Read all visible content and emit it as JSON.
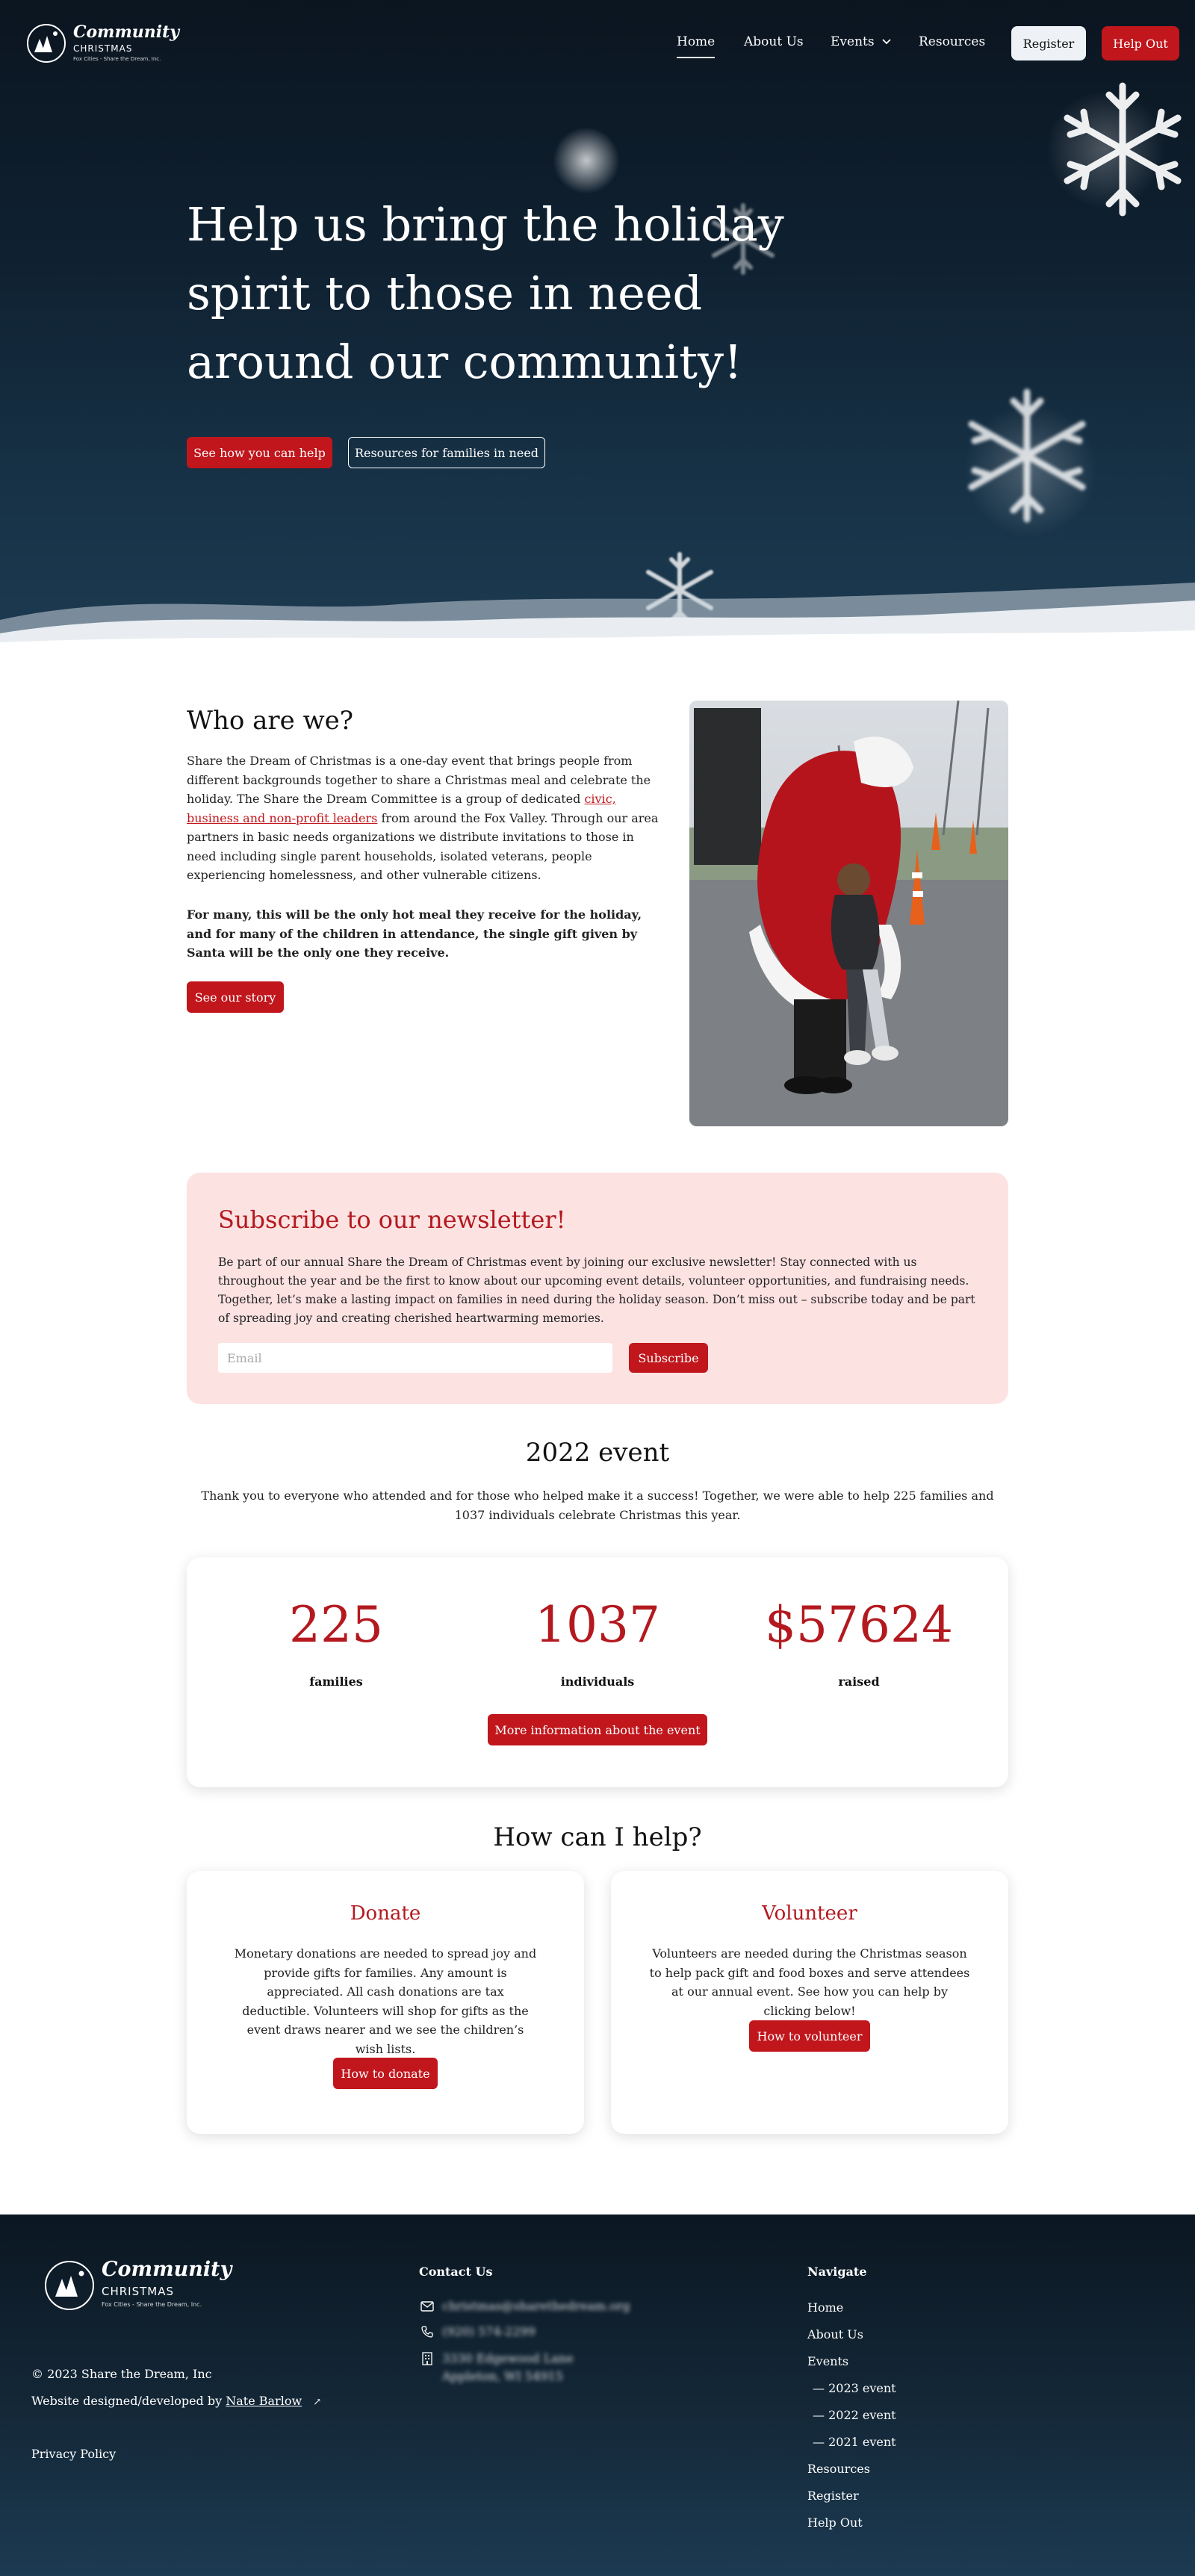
{
  "brand": {
    "script": "Community",
    "caps": "CHRISTMAS",
    "tagline": "Fox Cities - Share the Dream, Inc."
  },
  "nav": {
    "home": "Home",
    "about": "About Us",
    "events": "Events",
    "resources": "Resources",
    "register": "Register",
    "help_out": "Help Out"
  },
  "hero": {
    "title": "Help us bring the holiday spirit to those in need around our community!",
    "cta_primary": "See how you can help",
    "cta_secondary": "Resources for families in need"
  },
  "about": {
    "heading": "Who are we?",
    "p1_a": "Share the Dream of Christmas is a one-day event that brings people from different backgrounds together to share a Christmas meal and celebrate the holiday. The Share the Dream Committee is a group of dedicated ",
    "p1_link": "civic, business and non-profit leaders",
    "p1_b": " from around the Fox Valley. Through our area partners in basic needs organizations we distribute invitations to those in need including single parent households, isolated veterans, people experiencing homelessness, and other vulnerable citizens.",
    "p2": "For many, this will be the only hot meal they receive for the holiday, and for many of the children in attendance, the single gift given by Santa will be the only one they receive.",
    "button": "See our story"
  },
  "newsletter": {
    "heading": "Subscribe to our newsletter!",
    "body": "Be part of our annual Share the Dream of Christmas event by joining our exclusive newsletter! Stay connected with us throughout the year and be the first to know about our upcoming event details, volunteer opportunities, and fundraising needs. Together, let’s make a lasting impact on families in need during the holiday season. Don’t miss out – subscribe today and be part of spreading joy and creating cherished heartwarming memories.",
    "email_placeholder": "Email",
    "button": "Subscribe"
  },
  "event": {
    "heading": "2022 event",
    "text": "Thank you to everyone who attended and for those who helped make it a success! Together, we were able to help 225 families and 1037 individuals celebrate Christmas this year.",
    "stats": [
      {
        "value": "225",
        "label": "families"
      },
      {
        "value": "1037",
        "label": "individuals"
      },
      {
        "value": "$57624",
        "label": "raised"
      }
    ],
    "button": "More information about the event"
  },
  "help": {
    "heading": "How can I help?",
    "donate": {
      "title": "Donate",
      "text": "Monetary donations are needed to spread joy and provide gifts for families. Any amount is appreciated. All cash donations are tax deductible. Volunteers will shop for gifts as the event draws nearer and we see the children’s wish lists.",
      "button": "How to donate"
    },
    "volunteer": {
      "title": "Volunteer",
      "text": "Volunteers are needed during the Christmas season to help pack gift and food boxes and serve attendees at our annual event. See how you can help by clicking below!",
      "button": "How to volunteer"
    }
  },
  "footer": {
    "copyright": "© 2023 Share the Dream, Inc",
    "credit_prefix": "Website designed/developed by ",
    "credit_name": "Nate Barlow",
    "privacy": "Privacy Policy",
    "contact_heading": "Contact Us",
    "email": "christmas@sharethedream.org",
    "phone": "(920) 574-2299",
    "address1": "3330 Edgewood Lane",
    "address2": "Appleton, WI 54915",
    "navigate_heading": "Navigate",
    "nav": [
      "Home",
      "About Us",
      "Events",
      "— 2023 event",
      "— 2022 event",
      "— 2021 event",
      "Resources",
      "Register",
      "Help Out"
    ]
  }
}
